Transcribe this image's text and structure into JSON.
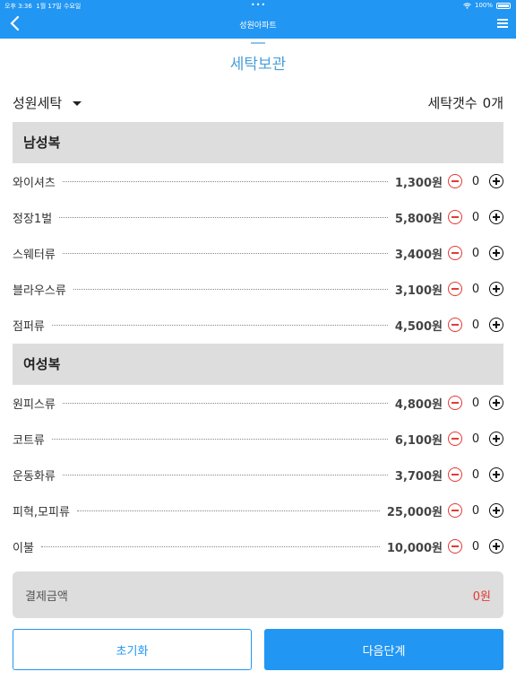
{
  "status": {
    "time": "오후 3:36",
    "date": "1월 17일 수요일",
    "dots": "•••",
    "battery": "100%"
  },
  "app": {
    "title": "성원아파트"
  },
  "page": {
    "title": "세탁보관"
  },
  "selector": {
    "value": "성원세탁"
  },
  "counter": {
    "label": "세탁갯수",
    "value": "0개"
  },
  "sections": [
    {
      "title": "남성복",
      "items": [
        {
          "name": "와이셔츠",
          "price": "1,300원",
          "qty": "0"
        },
        {
          "name": "정장1벌",
          "price": "5,800원",
          "qty": "0"
        },
        {
          "name": "스웨터류",
          "price": "3,400원",
          "qty": "0"
        },
        {
          "name": "블라우스류",
          "price": "3,100원",
          "qty": "0"
        },
        {
          "name": "점퍼류",
          "price": "4,500원",
          "qty": "0"
        }
      ]
    },
    {
      "title": "여성복",
      "items": [
        {
          "name": "원피스류",
          "price": "4,800원",
          "qty": "0"
        },
        {
          "name": "코트류",
          "price": "6,100원",
          "qty": "0"
        },
        {
          "name": "운동화류",
          "price": "3,700원",
          "qty": "0"
        },
        {
          "name": "피혁,모피류",
          "price": "25,000원",
          "qty": "0"
        },
        {
          "name": "이불",
          "price": "10,000원",
          "qty": "0"
        }
      ]
    }
  ],
  "total": {
    "label": "결제금액",
    "amount": "0원"
  },
  "buttons": {
    "reset": "초기화",
    "next": "다음단계"
  },
  "colors": {
    "accent": "#2196f3",
    "minus": "#e53935",
    "section_bg": "#dddddd"
  },
  "icons": {
    "back": "chevron-left-icon",
    "menu": "hamburger-icon",
    "minus": "minus-circle-icon",
    "plus": "plus-circle-icon",
    "dropdown": "caret-down-icon"
  }
}
